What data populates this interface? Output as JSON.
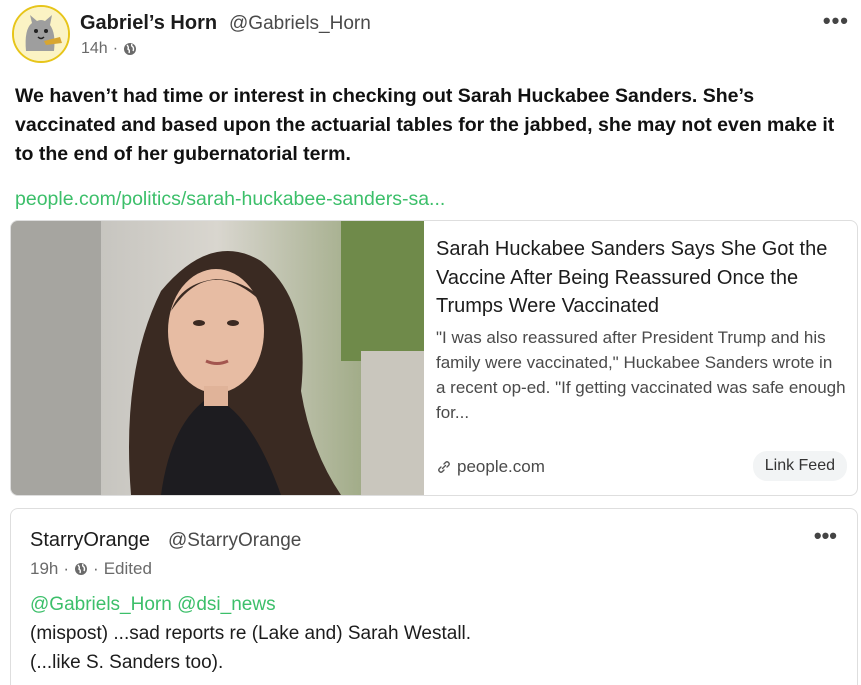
{
  "post": {
    "author_name": "Gabriel’s Horn",
    "author_handle": "@Gabriels_Horn",
    "time": "14h",
    "separator": "·",
    "more_label": "•••",
    "icons": {
      "more": "more-dots-icon",
      "visibility": "globe-icon"
    },
    "text": "We haven’t had time or interest in checking out Sarah Huckabee Sanders. She’s vaccinated and based upon the actuarial tables for the jabbed, she may not even make it to the end of her gubernatorial term.",
    "link_text": "people.com/politics/sarah-huckabee-sanders-sa..."
  },
  "link_card": {
    "title": "Sarah Huckabee Sanders Says She Got the Vaccine After Being Reassured Once the Trumps Were Vaccinated",
    "description": "\"I was also reassured after President Trump and his family were vaccinated,\" Huckabee Sanders wrote in a recent op-ed. \"If getting vaccinated was safe enough for...",
    "domain": "people.com",
    "badge": "Link Feed",
    "icons": {
      "domain": "link-icon"
    }
  },
  "reply": {
    "author_name": "StarryOrange",
    "author_handle": "@StarryOrange",
    "time": "19h",
    "separator": "·",
    "edited": "Edited",
    "more_label": "•••",
    "mention_1": "@Gabriels_Horn",
    "mention_2": "@dsi_news",
    "line_1": "(mispost) ...sad reports re (Lake and) Sarah Westall.",
    "line_2": "(...like S. Sanders too)."
  },
  "colors": {
    "accent_link": "#3cbf6a",
    "avatar_ring": "#e7c51a",
    "card_border": "#dedede"
  }
}
